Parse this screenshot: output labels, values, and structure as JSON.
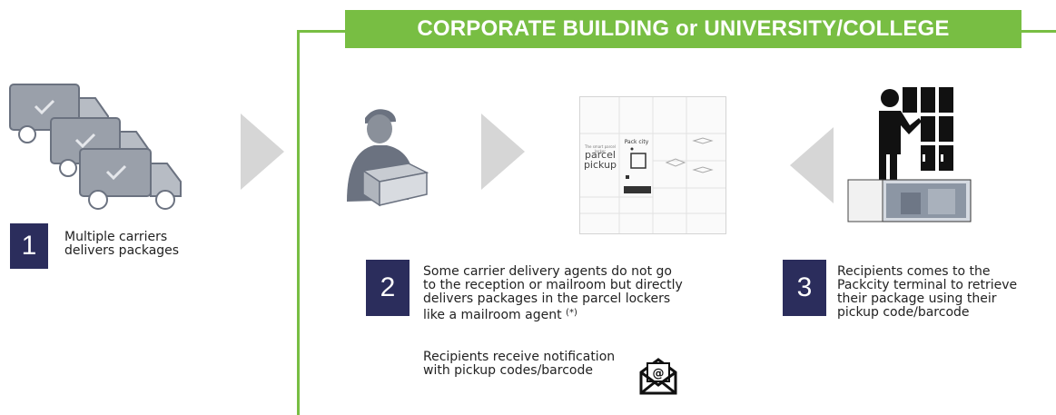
{
  "banner": {
    "title": "CORPORATE BUILDING or UNIVERSITY/COLLEGE"
  },
  "steps": [
    {
      "number": "1",
      "lines": [
        "Multiple carriers",
        "delivers packages"
      ]
    },
    {
      "number": "2",
      "lines": [
        "Some carrier delivery agents do not go",
        "to the reception or mailroom but directly",
        "delivers packages in the parcel lockers",
        "like a mailroom agent"
      ],
      "footnote": "(*)"
    },
    {
      "number": "3",
      "lines": [
        "Recipients comes to the",
        "Packcity terminal to retrieve",
        "their package using their",
        "pickup code/barcode"
      ]
    }
  ],
  "notification": {
    "lines": [
      "Recipients receive notification",
      "with pickup codes/barcode"
    ]
  },
  "locker_screen": {
    "small_text": "The smart parcel locker",
    "title_line1": "parcel",
    "title_line2": "pickup",
    "brand": "Pack city"
  },
  "icons": [
    "delivery-trucks-icon",
    "arrow-right-icon",
    "courier-icon",
    "parcel-locker-icon",
    "arrow-left-icon",
    "recipient-locker-icon",
    "email-envelope-icon"
  ],
  "colors": {
    "accent_green": "#78be43",
    "number_box": "#2b2d5c",
    "arrow_gray": "#d6d6d6",
    "icon_gray": "#6b7280"
  }
}
